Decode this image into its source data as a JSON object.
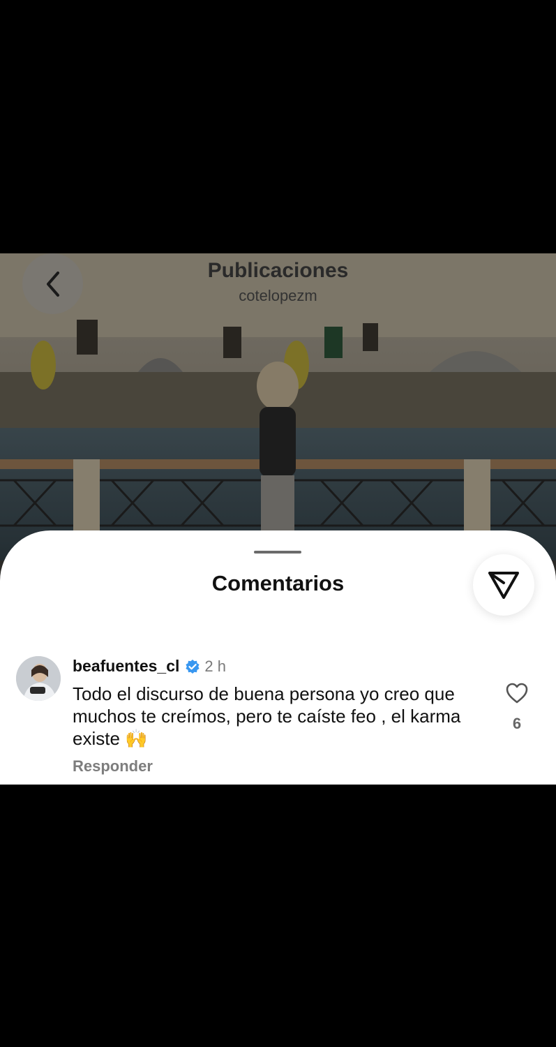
{
  "header": {
    "title": "Publicaciones",
    "subtitle": "cotelopezm"
  },
  "comments_panel": {
    "title": "Comentarios",
    "comment": {
      "username": "beafuentes_cl",
      "verified": true,
      "time": "2 h",
      "text": "Todo el discurso de buena persona yo creo que muchos te creímos, pero te caíste feo , el karma existe",
      "emoji": "🙌",
      "reply_label": "Responder",
      "like_count": "6"
    }
  },
  "icons": {
    "back": "chevron-left-icon",
    "filter": "filter-icon",
    "like": "heart-icon",
    "verified": "verified-badge-icon"
  },
  "colors": {
    "verified_blue": "#3897f0",
    "sheet_bg": "#ffffff"
  }
}
